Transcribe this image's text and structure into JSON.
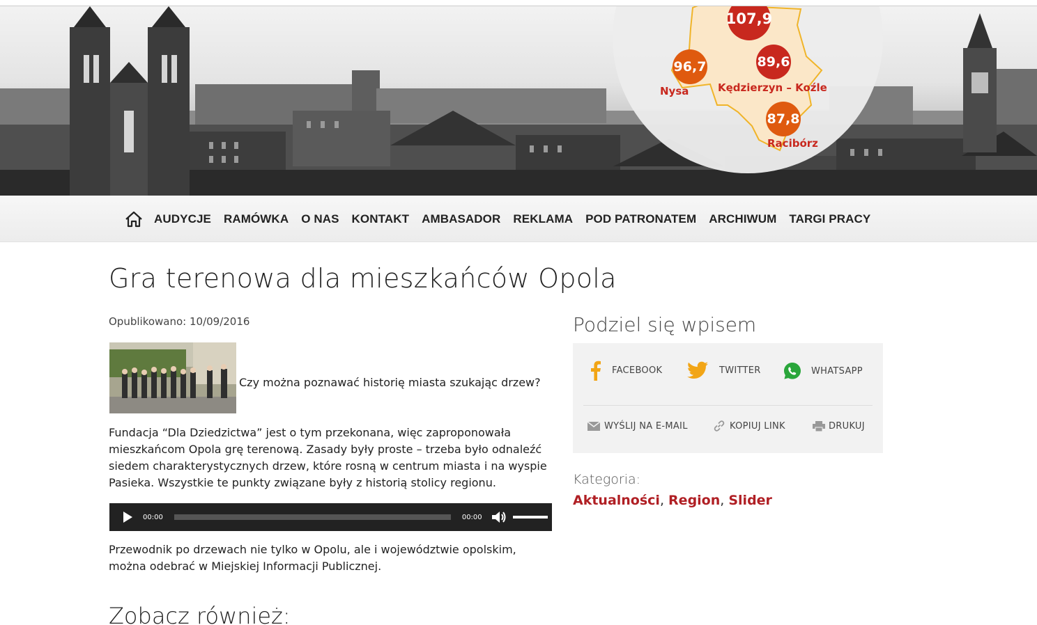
{
  "hero": {
    "frequencies": [
      {
        "value": "107,9",
        "color": "#c8281e"
      },
      {
        "value": "96,7",
        "color": "#df5a0f"
      },
      {
        "value": "89,6",
        "color": "#c8281e"
      },
      {
        "value": "87,8",
        "color": "#df5a0f"
      }
    ],
    "cities": [
      "Nysa",
      "Kędzierzyn – Koźle",
      "Racibórz"
    ]
  },
  "nav": {
    "home_icon": "home-icon",
    "items": [
      "AUDYCJE",
      "RAMÓWKA",
      "O NAS",
      "KONTAKT",
      "AMBASADOR",
      "REKLAMA",
      "POD PATRONATEM",
      "ARCHIWUM",
      "TARGI PRACY"
    ]
  },
  "article": {
    "title": "Gra terenowa dla mieszkańców Opola",
    "published": "Opublikowano: 10/09/2016",
    "lead": "Czy można poznawać historię miasta szukając drzew?",
    "paragraph1": "Fundacja “Dla Dziedzictwa” jest o tym przekonana, więc zaproponowała mieszkańcom Opola grę terenową. Zasady były proste – trzeba było odnaleźć siedem charakterystycznych drzew, które rosną w centrum miasta i na wyspie Pasieka. Wszystkie te punkty związane były z historią stolicy regionu.",
    "paragraph2": "Przewodnik po drzewach nie tylko w Opolu, ale i województwie opolskim, można odebrać w Miejskiej Informacji Publicznej.",
    "see_also": "Zobacz również:"
  },
  "player": {
    "current_time": "00:00",
    "duration": "00:00"
  },
  "share": {
    "heading": "Podziel się wpisem",
    "facebook": "FACEBOOK",
    "twitter": "TWITTER",
    "whatsapp": "WHATSAPP",
    "email": "WYŚLIJ NA E-MAIL",
    "copy_link": "KOPIUJ LINK",
    "print": "DRUKUJ",
    "colors": {
      "facebook": "#f2a516",
      "twitter": "#f2a516",
      "whatsapp": "#2aa63b"
    }
  },
  "category": {
    "label": "Kategoria:",
    "links": [
      "Aktualności",
      "Region",
      "Slider"
    ],
    "separator": ", "
  }
}
